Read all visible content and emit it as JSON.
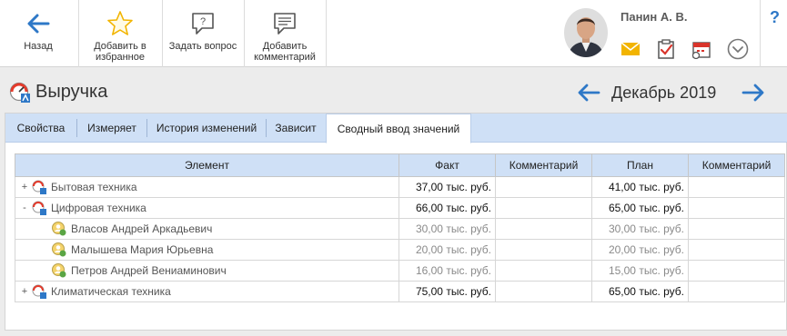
{
  "toolbar": {
    "back": "Назад",
    "favorite": "Добавить в\nизбранное",
    "ask": "Задать вопрос",
    "comment": "Добавить\nкомментарий"
  },
  "user": {
    "name": "Панин А. В."
  },
  "help": "?",
  "header": {
    "title": "Выручка",
    "period": "Декабрь 2019"
  },
  "tabs": [
    "Свойства",
    "Измеряет",
    "История изменений",
    "Зависит",
    "Сводный ввод значений"
  ],
  "active_tab": "Сводный ввод значений",
  "table": {
    "columns": [
      "Элемент",
      "Факт",
      "Комментарий",
      "План",
      "Комментарий"
    ],
    "rows": [
      {
        "expander": "+",
        "name": "Бытовая техника",
        "fact": "37,00 тыс. руб.",
        "fact_comment": "",
        "plan": "41,00 тыс. руб.",
        "plan_comment": ""
      },
      {
        "expander": "-",
        "name": "Цифровая техника",
        "fact": "66,00 тыс. руб.",
        "fact_comment": "",
        "plan": "65,00 тыс. руб.",
        "plan_comment": ""
      },
      {
        "expander": "",
        "name": "Власов Андрей Аркадьевич",
        "fact": "30,00 тыс. руб.",
        "fact_comment": "",
        "plan": "30,00 тыс. руб.",
        "plan_comment": ""
      },
      {
        "expander": "",
        "name": "Малышева Мария Юрьевна",
        "fact": "20,00 тыс. руб.",
        "fact_comment": "",
        "plan": "20,00 тыс. руб.",
        "plan_comment": ""
      },
      {
        "expander": "",
        "name": "Петров Андрей Вениаминович",
        "fact": "16,00 тыс. руб.",
        "fact_comment": "",
        "plan": "15,00 тыс. руб.",
        "plan_comment": ""
      },
      {
        "expander": "+",
        "name": "Климатическая техника",
        "fact": "75,00 тыс. руб.",
        "fact_comment": "",
        "plan": "65,00 тыс. руб.",
        "plan_comment": ""
      }
    ]
  },
  "colors": {
    "accent": "#2e78c7",
    "tab_bar": "#cfe0f6",
    "mail": "#f2b400",
    "calendar": "#d9342b"
  }
}
